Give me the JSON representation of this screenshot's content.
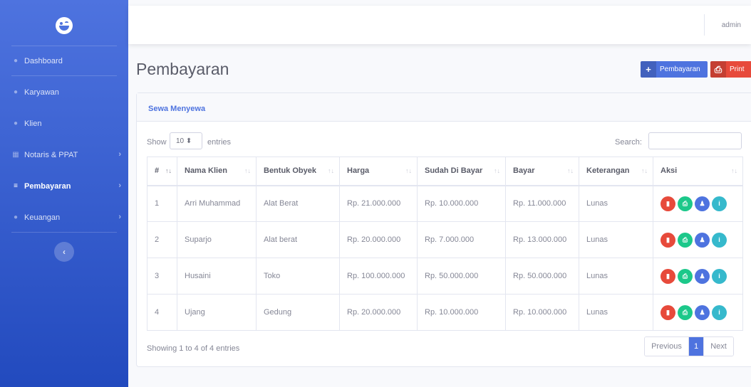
{
  "sidebar": {
    "items": [
      {
        "label": "Dashboard",
        "icon": "palette-icon",
        "glyph": "●"
      },
      {
        "label": "Karyawan",
        "icon": "user-icon",
        "glyph": "●"
      },
      {
        "label": "Klien",
        "icon": "user-plus-icon",
        "glyph": "●"
      },
      {
        "label": "Notaris & PPAT",
        "icon": "building-icon",
        "glyph": "▦"
      },
      {
        "label": "Pembayaran",
        "icon": "money-icon",
        "glyph": "≡"
      },
      {
        "label": "Keuangan",
        "icon": "coins-icon",
        "glyph": "●"
      }
    ],
    "toggle_glyph": "‹"
  },
  "topbar": {
    "user": "admin"
  },
  "page": {
    "title": "Pembayaran"
  },
  "toolbar": {
    "add_icon": "+",
    "add_label": "Pembayaran",
    "print_icon": "⎙",
    "print_label": "Print"
  },
  "card": {
    "title": "Sewa Menyewa"
  },
  "controls": {
    "show": "Show",
    "length_value": "10 ⬍",
    "entries": "entries",
    "search_label": "Search:"
  },
  "table": {
    "columns": [
      "#",
      "Nama Klien",
      "Bentuk Obyek",
      "Harga",
      "Sudah Di Bayar",
      "Bayar",
      "Keterangan",
      "Aksi"
    ],
    "rows": [
      [
        "1",
        "Arri Muhammad",
        "Alat Berat",
        "Rp. 21.000.000",
        "Rp. 10.000.000",
        "Rp. 11.000.000",
        "Lunas"
      ],
      [
        "2",
        "Suparjo",
        "Alat berat",
        "Rp. 20.000.000",
        "Rp. 7.000.000",
        "Rp. 13.000.000",
        "Lunas"
      ],
      [
        "3",
        "Husaini",
        "Toko",
        "Rp. 100.000.000",
        "Rp. 50.000.000",
        "Rp. 50.000.000",
        "Lunas"
      ],
      [
        "4",
        "Ujang",
        "Gedung",
        "Rp. 20.000.000",
        "Rp. 10.000.000",
        "Rp. 10.000.000",
        "Lunas"
      ]
    ],
    "action_glyphs": {
      "delete": "▮",
      "print": "⎙",
      "user": "♟",
      "info": "i"
    }
  },
  "footer": {
    "info": "Showing 1 to 4 of 4 entries",
    "previous": "Previous",
    "current": "1",
    "next": "Next"
  },
  "colors": {
    "primary": "#4e73df",
    "danger": "#e74a3b",
    "success": "#1cc88a",
    "info": "#36b9cc"
  }
}
